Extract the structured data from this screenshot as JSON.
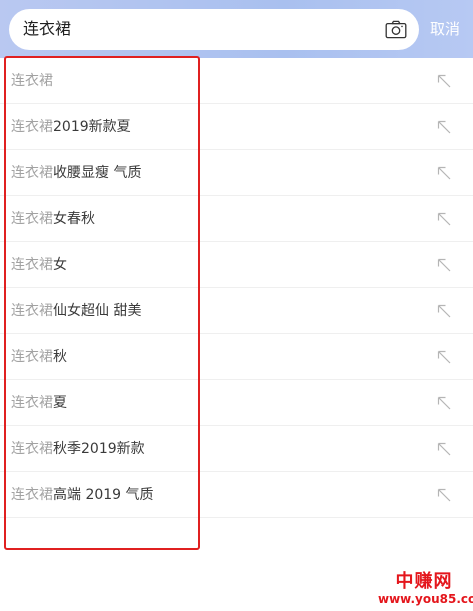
{
  "search": {
    "query": "连衣裙",
    "camera_icon": "camera-icon",
    "cancel_label": "取消"
  },
  "suggestions": [
    {
      "match": "连衣裙",
      "rest": ""
    },
    {
      "match": "连衣裙",
      "rest": "2019新款夏"
    },
    {
      "match": "连衣裙",
      "rest": "收腰显瘦 气质"
    },
    {
      "match": "连衣裙",
      "rest": "女春秋"
    },
    {
      "match": "连衣裙",
      "rest": "女"
    },
    {
      "match": "连衣裙",
      "rest": "仙女超仙 甜美"
    },
    {
      "match": "连衣裙",
      "rest": "秋"
    },
    {
      "match": "连衣裙",
      "rest": "夏"
    },
    {
      "match": "连衣裙",
      "rest": "秋季2019新款"
    },
    {
      "match": "连衣裙",
      "rest": "高端 2019 气质"
    }
  ],
  "suggestion_arrow_icon": "arrow-up-left-icon",
  "annotation": {
    "color": "#e02020"
  },
  "watermark": {
    "title": "中赚网",
    "url": "www.you85.com",
    "color": "#e4161c"
  },
  "colors": {
    "header_bg": "#b0c4f0",
    "match_text": "#a2a2a2",
    "rest_text": "#3a3a3a"
  }
}
